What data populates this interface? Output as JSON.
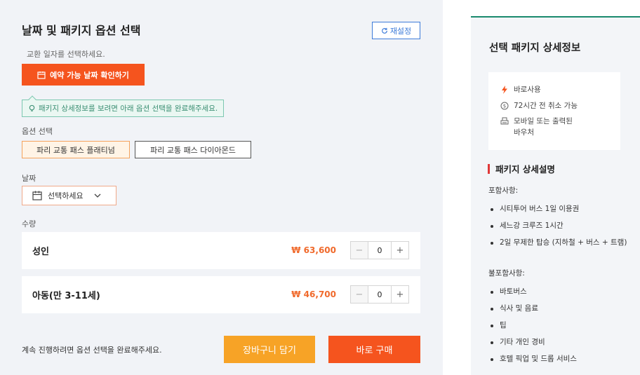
{
  "options": {
    "title": "날짜 및 패키지 옵션 선택",
    "reset_label": "재설정",
    "date_hint": "교환 일자를 선택하세요.",
    "date_check_label": "예약 가능 날짜 확인하기",
    "notice": "패키지 상세정보를 보려면 아래 옵션 선택을 완료해주세요.",
    "option_label": "옵션 선택",
    "option_items": [
      "파리 교통 패스 플래티넘",
      "파리 교통 패스 다이아몬드"
    ],
    "selected_option": "파리 교통 패스 플래티넘",
    "date_label": "날짜",
    "date_placeholder": "선택하세요",
    "qty_label": "수량",
    "quantities": [
      {
        "name": "성인",
        "price": "₩ 63,600",
        "value": "0"
      },
      {
        "name": "아동(만 3-11세)",
        "price": "₩ 46,700",
        "value": "0"
      }
    ],
    "footer_hint": "계속 진행하려면 옵션 선택을 완료해주세요.",
    "cart_label": "장바구니 담기",
    "buy_label": "바로 구매"
  },
  "detail": {
    "title": "선택 패키지 상세정보",
    "features": [
      {
        "icon": "lightning-icon",
        "text": "바로사용"
      },
      {
        "icon": "cancel-clock-icon",
        "text": "72시간 전 취소 가능"
      },
      {
        "icon": "voucher-icon",
        "text": "모바일 또는 출력된\n바우처"
      }
    ],
    "section_title": "패키지 상세설명",
    "included_label": "포함사항:",
    "included": [
      "시티투어 버스 1일 이용권",
      "세느강 크루즈 1시간",
      "2일 무제한 탑승 (지하철 + 버스 + 트램)"
    ],
    "excluded_label": "불포함사항:",
    "excluded": [
      "바토버스",
      "식사 및 음료",
      "팁",
      "기타 개인 경비",
      "호텔 픽업 및 드롭 서비스"
    ]
  },
  "colors": {
    "accent_orange": "#f5541e",
    "cart_yellow": "#f7a326",
    "price_orange": "#f06a2c",
    "link_blue": "#3d7bd9",
    "teal": "#1a8a6d"
  }
}
